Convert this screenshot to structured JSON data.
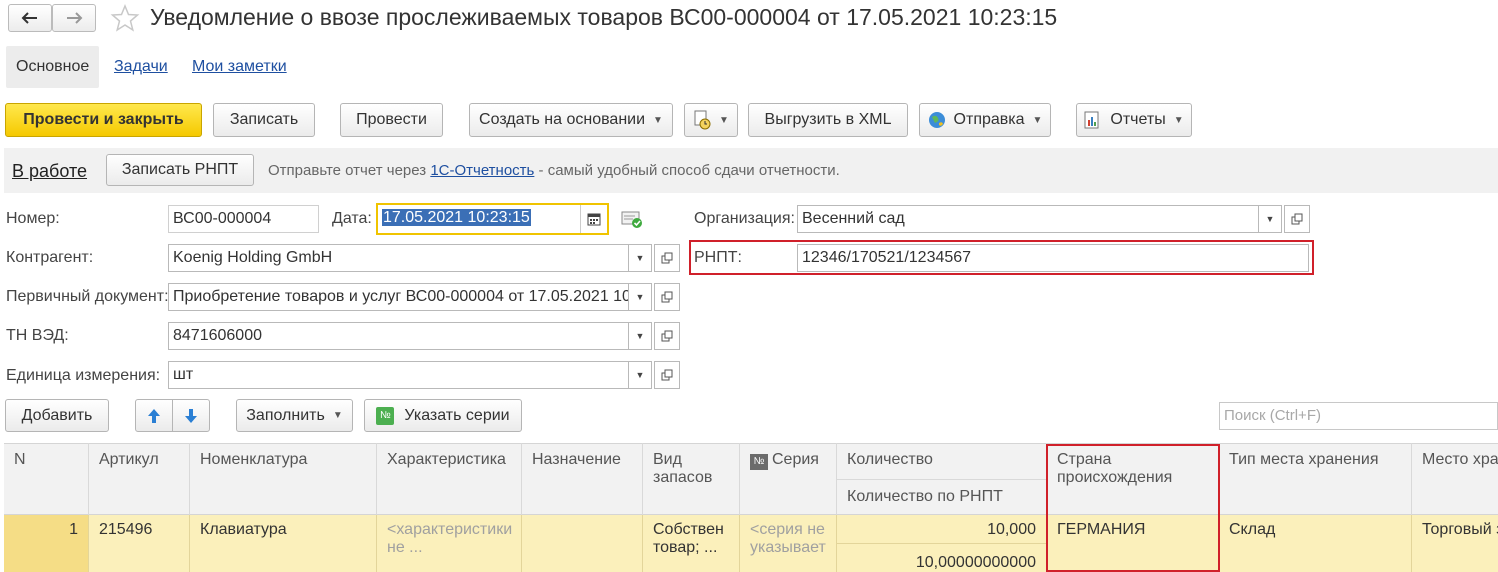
{
  "window": {
    "title": "Уведомление о ввозе прослеживаемых товаров ВС00-000004 от 17.05.2021 10:23:15"
  },
  "tabs": [
    {
      "label": "Основное",
      "active": true
    },
    {
      "label": "Задачи",
      "active": false
    },
    {
      "label": "Мои заметки",
      "active": false
    }
  ],
  "toolbar": {
    "post_close": "Провести и закрыть",
    "save": "Записать",
    "post": "Провести",
    "create_based": "Создать на основании",
    "export_xml": "Выгрузить в XML",
    "send": "Отправка",
    "reports": "Отчеты"
  },
  "status_bar": {
    "status": "В работе",
    "save_rnpt": "Записать РНПТ",
    "hint_before": "Отправьте отчет через ",
    "hint_link": "1С-Отчетность",
    "hint_after": " - самый удобный способ сдачи отчетности."
  },
  "form": {
    "number_label": "Номер:",
    "number_value": "ВС00-000004",
    "date_label": "Дата:",
    "date_value": "17.05.2021 10:23:15",
    "org_label": "Организация:",
    "org_value": "Весенний сад",
    "counterparty_label": "Контрагент:",
    "counterparty_value": "Koenig Holding GmbH",
    "rnpt_label": "РНПТ:",
    "rnpt_value": "12346/170521/1234567",
    "primary_doc_label": "Первичный документ:",
    "primary_doc_value": "Приобретение товаров и услуг ВС00-000004 от 17.05.2021 10:",
    "tnved_label": "ТН ВЭД:",
    "tnved_value": "8471606000",
    "unit_label": "Единица измерения:",
    "unit_value": "шт"
  },
  "table_toolbar": {
    "add": "Добавить",
    "fill": "Заполнить",
    "series": "Указать серии",
    "search_placeholder": "Поиск (Ctrl+F)"
  },
  "table": {
    "headers": {
      "n": "N",
      "article": "Артикул",
      "nomenclature": "Номенклатура",
      "characteristic": "Характеристика",
      "purpose": "Назначение",
      "stock_type": "Вид запасов",
      "series": "Серия",
      "quantity": "Количество",
      "quantity_rnpt": "Количество по РНПТ",
      "country": "Страна происхождения",
      "storage_type": "Тип места хранения",
      "storage_place": "Место хра"
    },
    "row": {
      "n": "1",
      "article": "215496",
      "nomenclature": "Клавиатура",
      "characteristic": "<характеристики не ...",
      "purpose": "",
      "stock_type": "Собствен товар; ...",
      "series": "<серия не указывает",
      "quantity": "10,000",
      "quantity_rnpt": "10,00000000000",
      "country": "ГЕРМАНИЯ",
      "storage_type": "Склад",
      "storage_place": "Торговый з"
    }
  },
  "colors": {
    "primary_button": "#f5c900",
    "link": "#1e4fa0",
    "highlight_row": "#fbf0bb",
    "red_frame": "#d0202a"
  }
}
